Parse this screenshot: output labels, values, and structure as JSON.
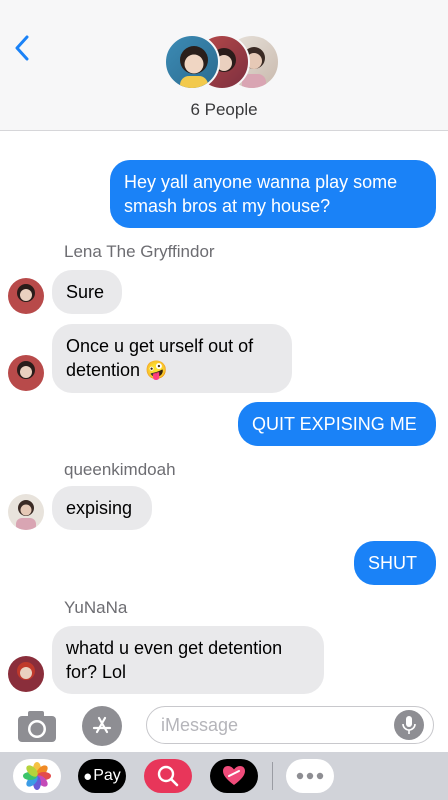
{
  "header": {
    "back_icon": "chevron-left-icon",
    "group_label": "6 People",
    "accent": "#1a82f7"
  },
  "messages": [
    {
      "from": "me",
      "text_lines": [
        "Hey yall anyone wanna play some",
        "smash bros at my house?"
      ]
    },
    {
      "sender": "Lena The Gryffindor"
    },
    {
      "from": "Lena The Gryffindor",
      "text": "Sure"
    },
    {
      "from": "Lena The Gryffindor",
      "text_lines": [
        "Once u get urself out of",
        "detention"
      ],
      "emoji": "🤪"
    },
    {
      "from": "me",
      "text": "QUIT EXPISING ME"
    },
    {
      "sender": "queenkimdoah"
    },
    {
      "from": "queenkimdoah",
      "text": "expising"
    },
    {
      "from": "me",
      "text": "SHUT"
    },
    {
      "sender": "YuNaNa"
    },
    {
      "from": "YuNaNa",
      "text_lines": [
        "whatd u even get detention",
        "for? Lol"
      ]
    }
  ],
  "input": {
    "placeholder": "iMessage",
    "camera_icon": "camera-icon",
    "appstore_icon": "app-store-icon",
    "mic_icon": "microphone-icon"
  },
  "drawer": {
    "apps": [
      "photos-icon",
      "apple-pay-button",
      "search-images-icon",
      "digital-touch-icon",
      "more-apps-icon"
    ],
    "pay_label": "Pay"
  },
  "colors": {
    "outgoing_bubble": "#1a82f7",
    "incoming_bubble": "#e9e9eb",
    "drawer_bg": "#d1d3d9"
  }
}
